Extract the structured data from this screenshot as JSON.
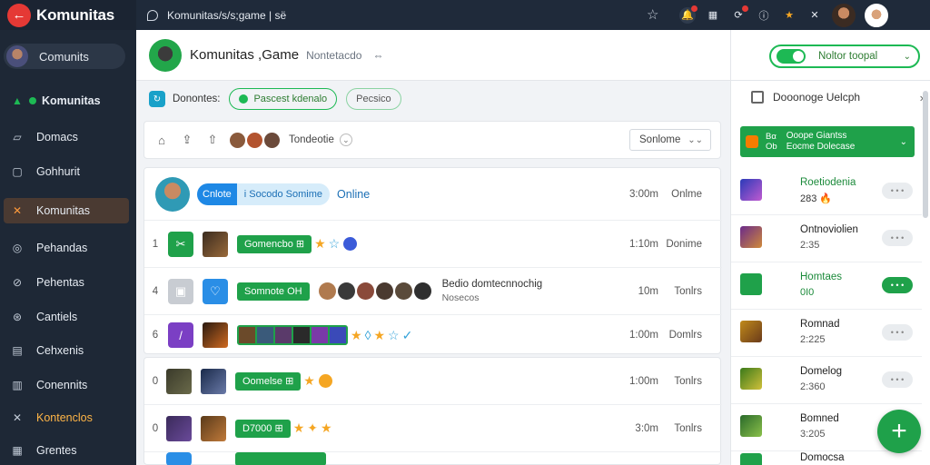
{
  "app": {
    "name": "Komunitas",
    "logo_glyph": "←"
  },
  "header": {
    "breadcrumb": "Komunitas/s/s;game | së",
    "star": "☆"
  },
  "sidebar": {
    "user_label": "Comunits",
    "items": [
      {
        "label": "Komunitas",
        "icon": "▲"
      },
      {
        "label": "Domacs",
        "icon": "▱"
      },
      {
        "label": "Gohhurit",
        "icon": "▢"
      },
      {
        "label": "Komunitas",
        "icon": "✕"
      },
      {
        "label": "Pehandas",
        "icon": "◎"
      },
      {
        "label": "Pehentas",
        "icon": "⊘"
      },
      {
        "label": "Cantiels",
        "icon": "⊛"
      },
      {
        "label": "Cehxenis",
        "icon": "▤"
      },
      {
        "label": "Conennits",
        "icon": "▥"
      },
      {
        "label": "Kontenclos",
        "icon": "✕"
      },
      {
        "label": "Grentes",
        "icon": "▦"
      }
    ]
  },
  "main": {
    "title": "Komunitas ,Game",
    "subtitle": "Nontetacdo",
    "menu_glyph": "⇔",
    "tab_label": "Donontes:",
    "pill_active": "Pascest kdenalo",
    "pill_outline": "Pecsico",
    "toolbar_label": "Tondeotie",
    "sort_label": "Sonlome",
    "first_row": {
      "badge_left": "Cnlote",
      "badge_right": "i Socodo Somime",
      "status": "Online",
      "time": "3:00m",
      "time2": "Onlme"
    },
    "rows": [
      {
        "num": "1",
        "badge": "Gomencbo  ⊞",
        "time": "1:10m",
        "time2": "Donime"
      },
      {
        "num": "4",
        "badge": "Somnote  OH",
        "title": "Bedio domtecnnochig",
        "sub": "Nosecos",
        "time": "10m",
        "time2": "Tonlrs"
      },
      {
        "num": "6",
        "time": "1:00m",
        "time2": "Domlrs"
      },
      {
        "num": "0",
        "badge": "Oomelse  ⊞",
        "time": "1:00m",
        "time2": "Tonlrs"
      },
      {
        "num": "0",
        "badge": "D7000  ⊞",
        "time": "3:0m",
        "time2": "Tonlrs"
      }
    ]
  },
  "right": {
    "notif_label": "Noltor toopal",
    "section_title": "Dooonoge Uelcph",
    "banner": {
      "num1": "Bα",
      "num2": "Ob",
      "line1": "Ooope Giantss",
      "line2": "Eocme Dolecase"
    },
    "items": [
      {
        "title": "Roetiodenia",
        "sub": "283 🔥",
        "btn": "• • •"
      },
      {
        "title": "Ontnoviolien",
        "sub": "2:35",
        "btn": "• • •"
      },
      {
        "title": "Homtaes",
        "sub": "0I0",
        "btn": "• • •"
      },
      {
        "title": "Romnad",
        "sub": "2:225",
        "btn": "• • •"
      },
      {
        "title": "Domelog",
        "sub": "2:360",
        "btn": "• • •"
      },
      {
        "title": "Bomned",
        "sub": "3:205",
        "btn": ""
      },
      {
        "title": "Domocsa",
        "sub": "",
        "btn": ""
      }
    ]
  },
  "fab_label": "+"
}
